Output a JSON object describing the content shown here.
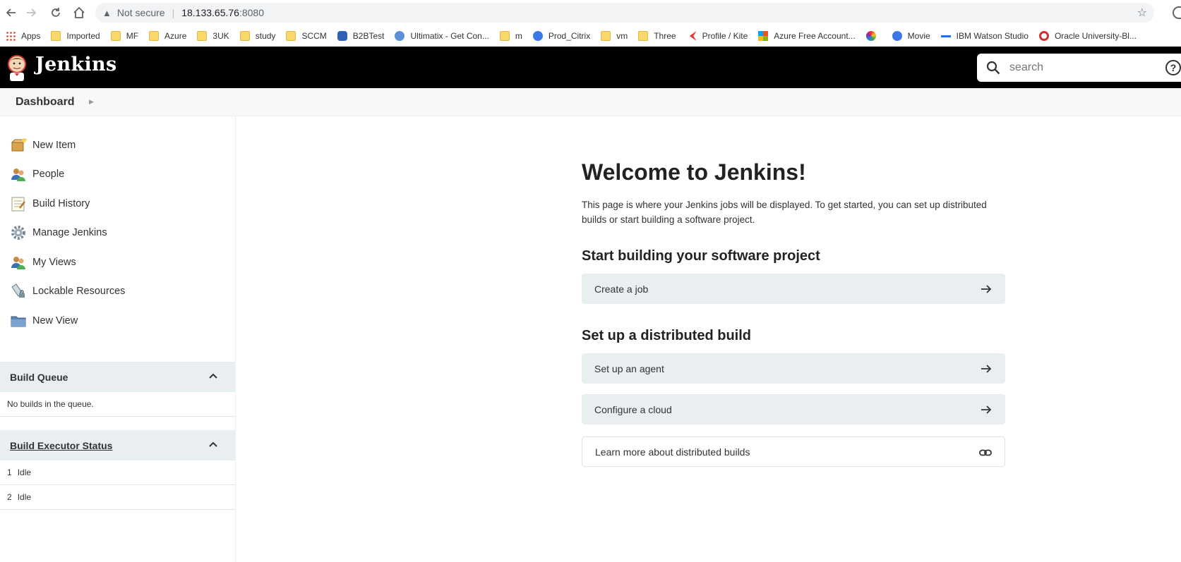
{
  "browser": {
    "security_label": "Not secure",
    "url_host": "18.133.65.76",
    "url_port": ":8080",
    "bookmarks": [
      {
        "label": "Apps",
        "icon": "apps-grid-icon"
      },
      {
        "label": "Imported",
        "icon": "folder-icon"
      },
      {
        "label": "MF",
        "icon": "folder-icon"
      },
      {
        "label": "Azure",
        "icon": "folder-icon"
      },
      {
        "label": "3UK",
        "icon": "folder-icon"
      },
      {
        "label": "study",
        "icon": "folder-icon"
      },
      {
        "label": "SCCM",
        "icon": "folder-icon"
      },
      {
        "label": "B2BTest",
        "icon": "lock-site-icon"
      },
      {
        "label": "Ultimatix - Get Con...",
        "icon": "tata-icon"
      },
      {
        "label": "m",
        "icon": "folder-icon"
      },
      {
        "label": "Prod_Citrix",
        "icon": "citrix-icon"
      },
      {
        "label": "vm",
        "icon": "folder-icon"
      },
      {
        "label": "Three",
        "icon": "folder-icon"
      },
      {
        "label": "Profile / Kite",
        "icon": "kite-icon"
      },
      {
        "label": "Azure Free Account...",
        "icon": "microsoft-icon"
      },
      {
        "label": "",
        "icon": "multicolor-site-icon"
      },
      {
        "label": "Movie",
        "icon": "globe-icon"
      },
      {
        "label": "IBM Watson Studio",
        "icon": "key-icon"
      },
      {
        "label": "Oracle University-Bl...",
        "icon": "oracle-icon"
      }
    ]
  },
  "header": {
    "brand": "Jenkins",
    "search_placeholder": "search"
  },
  "breadcrumb": {
    "dashboard": "Dashboard"
  },
  "sidebar": {
    "tasks": [
      {
        "label": "New Item",
        "icon": "new-item-icon"
      },
      {
        "label": "People",
        "icon": "people-icon"
      },
      {
        "label": "Build History",
        "icon": "build-history-icon"
      },
      {
        "label": "Manage Jenkins",
        "icon": "gear-icon"
      },
      {
        "label": "My Views",
        "icon": "people-icon"
      },
      {
        "label": "Lockable Resources",
        "icon": "lockable-resources-icon"
      },
      {
        "label": "New View",
        "icon": "folder-icon"
      }
    ],
    "build_queue": {
      "title": "Build Queue",
      "empty_text": "No builds in the queue."
    },
    "executor_status": {
      "title": "Build Executor Status",
      "executors": [
        {
          "number": "1",
          "state": "Idle"
        },
        {
          "number": "2",
          "state": "Idle"
        }
      ]
    }
  },
  "main": {
    "welcome_title": "Welcome to Jenkins!",
    "intro": "This page is where your Jenkins jobs will be displayed. To get started, you can set up distributed builds or start building a software project.",
    "section_project": "Start building your software project",
    "create_job": "Create a job",
    "section_distributed": "Set up a distributed build",
    "setup_agent": "Set up an agent",
    "configure_cloud": "Configure a cloud",
    "learn_more": "Learn more about distributed builds"
  }
}
